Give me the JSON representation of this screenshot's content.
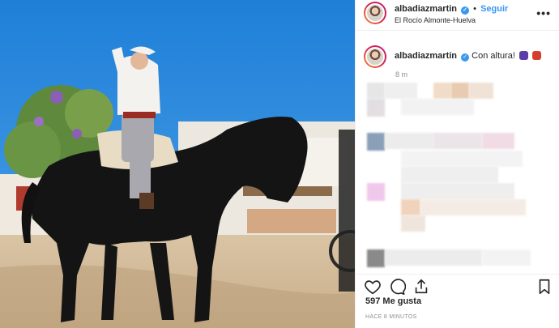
{
  "post": {
    "username": "albadiazmartin",
    "separator": "•",
    "follow_label": "Seguir",
    "location": "El Rocío Almonte-Huelva",
    "more_icon": "more-options-icon",
    "caption_text": "Con altura!",
    "caption_emojis": [
      "grapes-emoji",
      "flamenco-dancer-emoji"
    ],
    "time_ago": "8 m",
    "likes": "597 Me gusta",
    "timestamp": "HACE 8 MINUTOS",
    "verified_icon": "verified-badge-icon",
    "colors": {
      "link": "#3897f0",
      "muted": "#8e8e8e",
      "sky": "#2f8be0"
    }
  },
  "actions": {
    "like_icon": "heart-icon",
    "comment_icon": "comment-icon",
    "share_icon": "share-icon",
    "save_icon": "bookmark-icon"
  },
  "comments": {
    "state": "pixelated / hidden"
  }
}
